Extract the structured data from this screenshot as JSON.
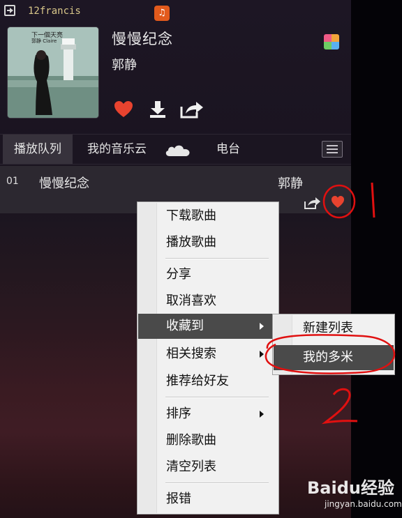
{
  "header": {
    "username": "12francis"
  },
  "now_playing": {
    "song_title": "慢慢纪念",
    "artist": "郭静",
    "cover_text": "下一個天亮",
    "cover_subtext": "郭静 Claire"
  },
  "tabs": [
    {
      "label": "播放队列",
      "active": true
    },
    {
      "label": "我的音乐云",
      "active": false
    },
    {
      "label": "电台",
      "active": false
    }
  ],
  "queue": [
    {
      "num": "01",
      "title": "慢慢纪念",
      "artist": "郭静"
    }
  ],
  "context_menu": {
    "items": [
      {
        "label": "下载歌曲"
      },
      {
        "label": "播放歌曲"
      },
      {
        "label": "分享"
      },
      {
        "label": "取消喜欢"
      },
      {
        "label": "收藏到",
        "has_submenu": true,
        "highlighted": true
      },
      {
        "label": "相关搜索",
        "has_submenu": true
      },
      {
        "label": "推荐给好友"
      },
      {
        "label": "排序",
        "has_submenu": true
      },
      {
        "label": "删除歌曲"
      },
      {
        "label": "清空列表"
      },
      {
        "label": "报错"
      }
    ]
  },
  "submenu": {
    "items": [
      {
        "label": "新建列表"
      },
      {
        "label": "我的多米",
        "highlighted": true
      }
    ]
  },
  "annotations": {
    "mark_1": "1",
    "mark_2": "2"
  },
  "watermark": {
    "logo": "Baidu经验",
    "url": "jingyan.baidu.com"
  },
  "colors": {
    "heart": "#e8432f",
    "annotation_red": "#e01010",
    "menu_highlight": "#4a4a4a"
  }
}
